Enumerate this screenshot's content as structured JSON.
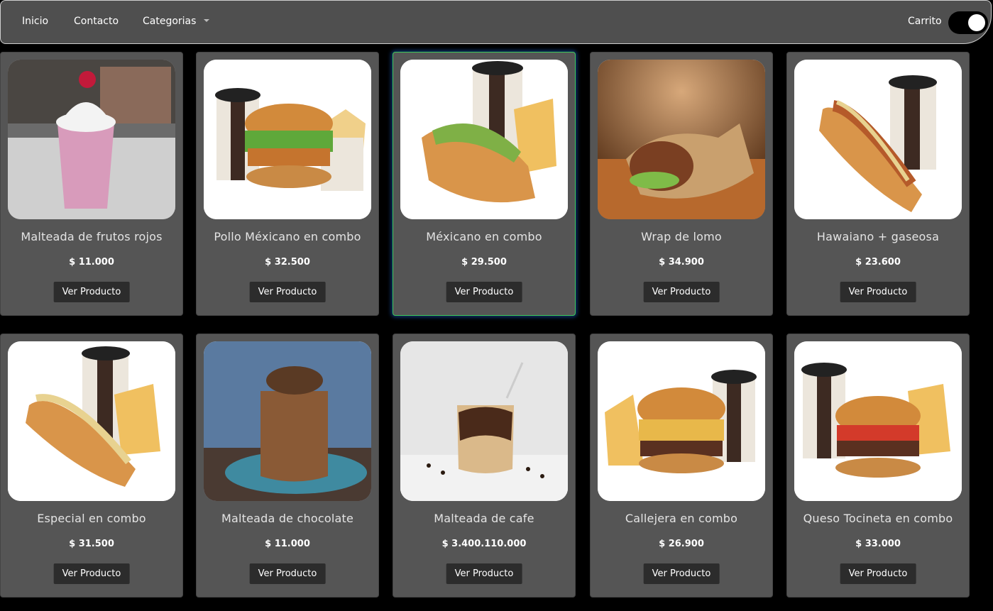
{
  "nav": {
    "items": [
      "Inicio",
      "Contacto",
      "Categorias"
    ],
    "cart_label": "Carrito",
    "cart_toggle_on": true
  },
  "products": [
    {
      "name": "Malteada de frutos rojos",
      "price": "$ 11.000",
      "button": "Ver Producto",
      "image": "malteada-frutos-rojos"
    },
    {
      "name": "Pollo Méxicano en combo",
      "price": "$ 32.500",
      "button": "Ver Producto",
      "image": "burger-combo"
    },
    {
      "name": "Méxicano en combo",
      "price": "$ 29.500",
      "button": "Ver Producto",
      "image": "hotdog-combo"
    },
    {
      "name": "Wrap de lomo",
      "price": "$ 34.900",
      "button": "Ver Producto",
      "image": "wrap"
    },
    {
      "name": "Hawaiano + gaseosa",
      "price": "$ 23.600",
      "button": "Ver Producto",
      "image": "hotdog-soda"
    },
    {
      "name": "Especial en combo",
      "price": "$ 31.500",
      "button": "Ver Producto",
      "image": "hotdog-combo"
    },
    {
      "name": "Malteada de chocolate",
      "price": "$ 11.000",
      "button": "Ver Producto",
      "image": "malteada-chocolate"
    },
    {
      "name": "Malteada de cafe",
      "price": "$ 3.400.110.000",
      "button": "Ver Producto",
      "image": "malteada-cafe"
    },
    {
      "name": "Callejera en combo",
      "price": "$ 26.900",
      "button": "Ver Producto",
      "image": "burger-combo"
    },
    {
      "name": "Queso Tocineta en combo",
      "price": "$ 33.000",
      "button": "Ver Producto",
      "image": "burger-combo"
    }
  ],
  "colors": {
    "card_bg": "#555555",
    "nav_bg": "#4f4f4f",
    "button_bg": "#2c2c2c",
    "active_border": "#3ec95a"
  }
}
